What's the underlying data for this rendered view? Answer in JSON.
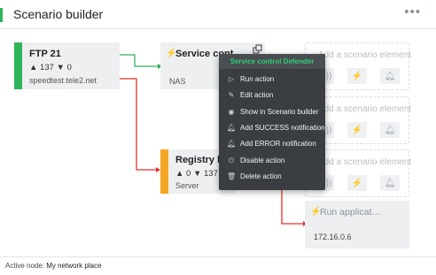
{
  "header": {
    "title": "Scenario builder",
    "more_icon": "more-horizontal-icon"
  },
  "nodes": {
    "ftp": {
      "title": "FTP 21",
      "stats": "▲ 137 ▼ 0",
      "subtitle": "speedtest.tele2.net",
      "color": "#2fb55a"
    },
    "service": {
      "title": "Service cont…",
      "subtitle": "NAS",
      "icon": "lightning-icon"
    },
    "registry": {
      "title": "Registry ke…",
      "stats": "▲ 0 ▼ 137",
      "subtitle": "Server",
      "color": "#f5a623"
    },
    "run_app": {
      "title": "Run applicat…",
      "subtitle": "172.16.0.6",
      "icon": "lightning-icon"
    }
  },
  "placeholders": [
    {
      "label": "Add a scenario element"
    },
    {
      "label": "Add a scenario element"
    },
    {
      "label": "Add a scenario element"
    }
  ],
  "context_menu": {
    "header": "Service control Defender",
    "items": [
      {
        "label": "Run action",
        "icon": "play-icon"
      },
      {
        "label": "Edit action",
        "icon": "pencil-icon"
      },
      {
        "label": "Show in Scenario builder",
        "icon": "eye-icon"
      },
      {
        "label": "Add SUCCESS notification",
        "icon": "bell-icon"
      },
      {
        "label": "Add ERROR notification",
        "icon": "bell-icon"
      },
      {
        "label": "Disable action",
        "icon": "power-icon"
      },
      {
        "label": "Delete action",
        "icon": "trash-icon"
      }
    ]
  },
  "footer": {
    "label": "Active node:",
    "value": "My network place"
  },
  "colors": {
    "success_wire": "#2fb55a",
    "error_wire": "#e3322b",
    "accent": "#2fb55a"
  }
}
